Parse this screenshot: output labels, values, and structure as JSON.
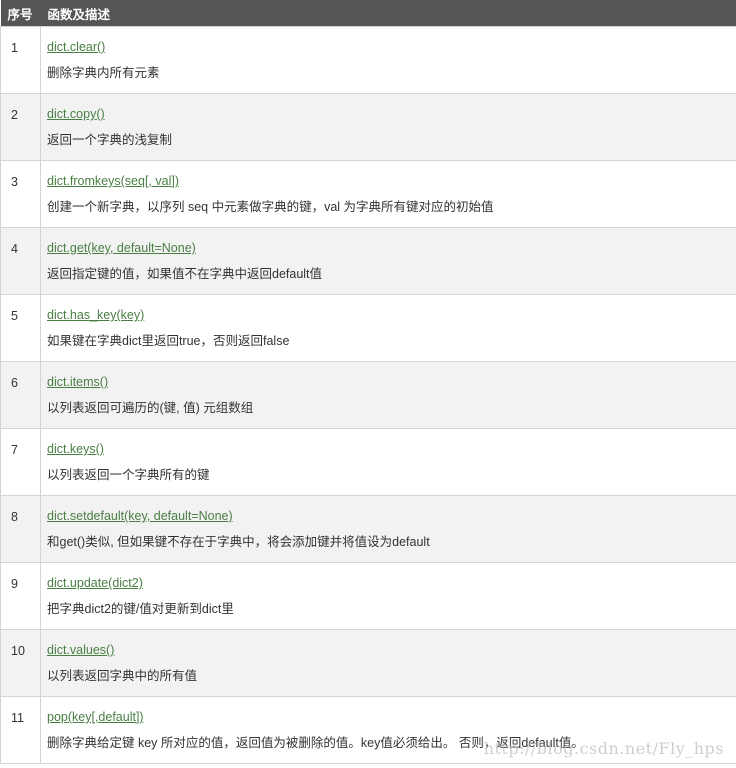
{
  "table": {
    "headers": [
      "序号",
      "函数及描述"
    ],
    "rows": [
      {
        "num": "1",
        "func": "dict.clear()",
        "desc": "删除字典内所有元素"
      },
      {
        "num": "2",
        "func": "dict.copy()",
        "desc": "返回一个字典的浅复制"
      },
      {
        "num": "3",
        "func": "dict.fromkeys(seq[, val])",
        "desc": "创建一个新字典，以序列 seq 中元素做字典的键，val 为字典所有键对应的初始值"
      },
      {
        "num": "4",
        "func": "dict.get(key, default=None)",
        "desc": "返回指定键的值，如果值不在字典中返回default值"
      },
      {
        "num": "5",
        "func": "dict.has_key(key)",
        "desc": "如果键在字典dict里返回true，否则返回false"
      },
      {
        "num": "6",
        "func": "dict.items()",
        "desc": "以列表返回可遍历的(键, 值) 元组数组"
      },
      {
        "num": "7",
        "func": "dict.keys()",
        "desc": "以列表返回一个字典所有的键"
      },
      {
        "num": "8",
        "func": "dict.setdefault(key, default=None)",
        "desc": "和get()类似, 但如果键不存在于字典中，将会添加键并将值设为default"
      },
      {
        "num": "9",
        "func": "dict.update(dict2)",
        "desc": "把字典dict2的键/值对更新到dict里"
      },
      {
        "num": "10",
        "func": "dict.values()",
        "desc": "以列表返回字典中的所有值"
      },
      {
        "num": "11",
        "func": "pop(key[,default])",
        "desc": "删除字典给定键 key 所对应的值，返回值为被删除的值。key值必须给出。 否则，返回default值。"
      }
    ]
  },
  "watermark": "http://blog.csdn.net/Fly_hps"
}
